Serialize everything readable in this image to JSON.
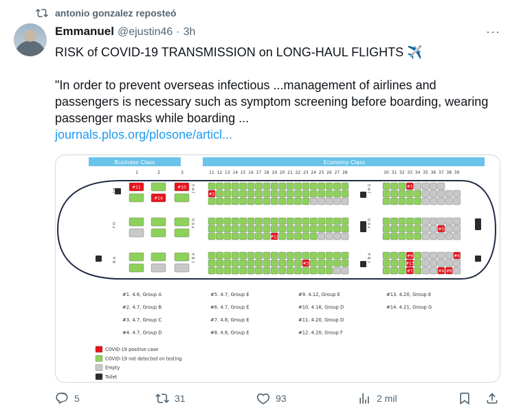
{
  "repost": {
    "label": "antonio gonzalez reposteó"
  },
  "tweet": {
    "name": "Emmanuel",
    "handle": "@ejustin46",
    "sep": "·",
    "time": "3h",
    "more": "···",
    "title_line": "RISK of COVID-19 TRANSMISSION on LONG-HAUL FLIGHTS ✈️",
    "quote": "\"In order to prevent overseas infectious ...management of airlines and passengers is necessary such as symptom screening before boarding, wearing passenger masks while boarding ...",
    "link": "journals.plos.org/plosone/articl..."
  },
  "figure": {
    "business_label": "Business Class",
    "economy_label": "Economy Class",
    "business_cols": [
      "1",
      "2",
      "3"
    ],
    "economy_cols": [
      "11",
      "12",
      "13",
      "14",
      "15",
      "16",
      "17",
      "18",
      "19",
      "20",
      "21",
      "22",
      "23",
      "24",
      "25",
      "26",
      "27",
      "28"
    ],
    "rear_cols": [
      "30",
      "31",
      "32",
      "33",
      "34",
      "35",
      "36",
      "37",
      "38",
      "39"
    ],
    "cases": [
      [
        "#1. 4.6, Group A",
        "#2. 4.7, Group B",
        "#3. 4.7, Group C",
        "#4. 4.7, Group D"
      ],
      [
        "#5. 4.7, Group E",
        "#6. 4.7, Group E",
        "#7. 4.8, Group E",
        "#8. 4.8, Group E"
      ],
      [
        "#9. 4.12, Group E",
        "#10. 4.16, Group D",
        "#11. 4.20, Group D",
        "#12. 4.20, Group F"
      ],
      [
        "#13. 4.20, Group E",
        "#14. 4.21, Group G"
      ]
    ],
    "legend": [
      {
        "label": "COVID-19 positive case",
        "color": "#e8141c"
      },
      {
        "label": "COVID-19 not detected on testing",
        "color": "#8dd15a"
      },
      {
        "label": "Empty",
        "color": "#c8c8c8"
      },
      {
        "label": "Toilet",
        "color": "#2b2b2b"
      }
    ]
  },
  "actions": {
    "replies": "5",
    "reposts": "31",
    "likes": "93",
    "views": "2 mil"
  },
  "colors": {
    "accent": "#1d9bf0",
    "muted": "#536471",
    "positive": "#e8141c",
    "negative": "#8dd15a",
    "empty": "#c8c8c8"
  }
}
